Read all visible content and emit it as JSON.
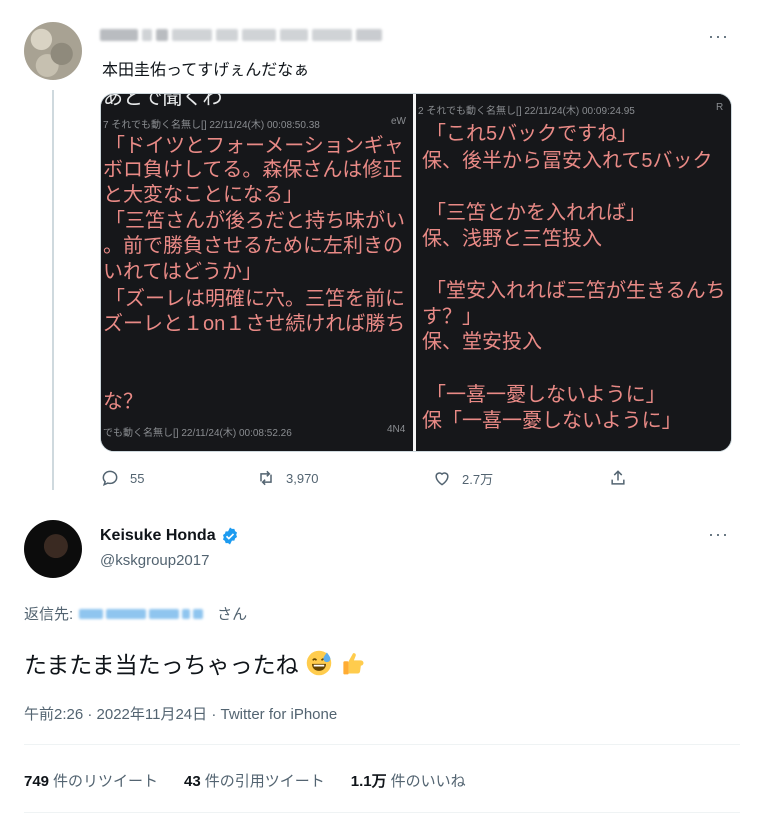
{
  "parent_tweet": {
    "text": "本田圭佑ってすげぇんだなぁ",
    "more_label": "···",
    "media": {
      "left_panel": {
        "top_cut_line": "あとで聞くわ",
        "meta_top": "7 それでも動く名無し[] 22/11/24(木) 00:08:50.38",
        "meta_top_id": "eW",
        "lines": [
          "「ドイツとフォーメーションギャ",
          "ボロ負けしてる。森保さんは修正",
          "と大変なことになる」",
          "「三笘さんが後ろだと持ち味がい",
          "。前で勝負させるために左利きの",
          "いれてはどうか」",
          "「ズーレは明確に穴。三笘を前に",
          "ズーレと１on１させ続ければ勝ち",
          "",
          "な？"
        ],
        "meta_bottom": "でも動く名無し[] 22/11/24(木) 00:08:52.26",
        "meta_bottom_id": "4N4"
      },
      "right_panel": {
        "meta_top": "2 それでも動く名無し[] 22/11/24(木) 00:09:24.95",
        "meta_top_id": "R",
        "lines": [
          "「これ5バックですね」",
          "保、後半から冨安入れて5バック",
          "",
          "「三笘とかを入れれば」",
          "保、浅野と三笘投入",
          "",
          "「堂安入れれば三笘が生きるんち",
          "す？」",
          "保、堂安投入",
          "",
          "「一喜一憂しないように」",
          "保「一喜一憂しないように」"
        ]
      }
    },
    "actions": {
      "reply_count": "55",
      "retweet_count": "3,970",
      "like_count": "2.7万"
    }
  },
  "main_tweet": {
    "display_name": "Keisuke Honda",
    "handle": "@kskgroup2017",
    "more_label": "···",
    "reply_prefix": "返信先:",
    "reply_suffix": "さん",
    "text": "たまたま当たっちゃったね",
    "timestamp": "午前2:26 · 2022年11月24日 · Twitter for iPhone",
    "stats": {
      "retweets_count": "749",
      "retweets_label": "件のリツイート",
      "quotes_count": "43",
      "quotes_label": "件の引用ツイート",
      "likes_count": "1.1万",
      "likes_label": "件のいいね"
    }
  },
  "colors": {
    "verified": "#1d9bf0",
    "secondary_text": "#536471",
    "quote_text": "#e98a86",
    "media_bg": "#16171a"
  }
}
